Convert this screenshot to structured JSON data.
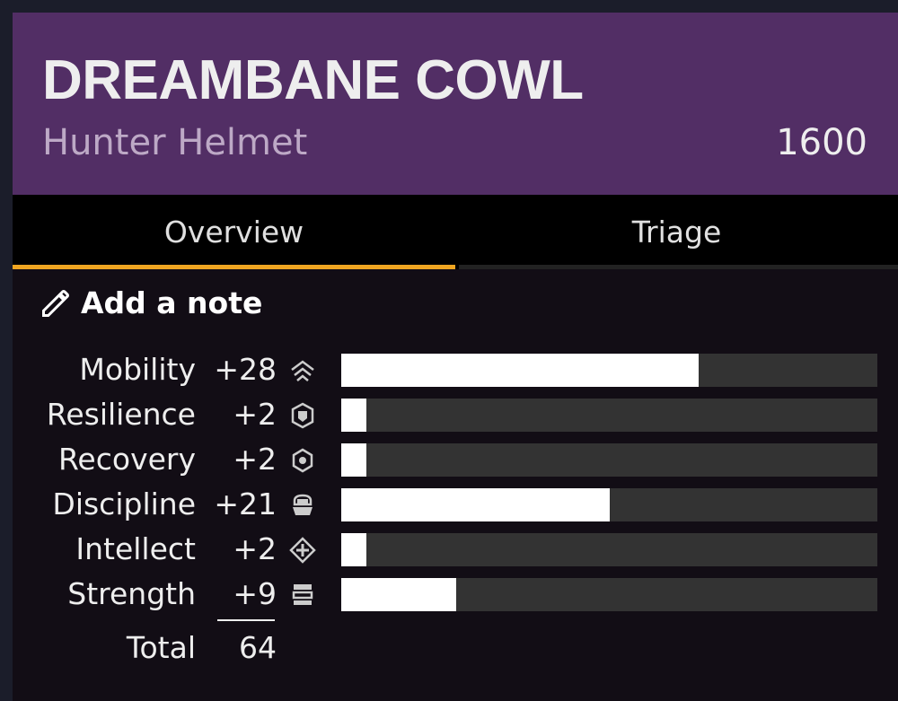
{
  "item": {
    "name": "DREAMBANE COWL",
    "type": "Hunter Helmet",
    "power": "1600"
  },
  "tabs": [
    {
      "label": "Overview",
      "active": true
    },
    {
      "label": "Triage",
      "active": false
    }
  ],
  "note": {
    "label": "Add a note",
    "icon": "pencil-icon"
  },
  "stat_max": 42,
  "stats": [
    {
      "name": "Mobility",
      "value": "+28",
      "amount": 28,
      "icon": "mobility-icon"
    },
    {
      "name": "Resilience",
      "value": "+2",
      "amount": 2,
      "icon": "resilience-icon"
    },
    {
      "name": "Recovery",
      "value": "+2",
      "amount": 2,
      "icon": "recovery-icon"
    },
    {
      "name": "Discipline",
      "value": "+21",
      "amount": 21,
      "icon": "discipline-icon"
    },
    {
      "name": "Intellect",
      "value": "+2",
      "amount": 2,
      "icon": "intellect-icon"
    },
    {
      "name": "Strength",
      "value": "+9",
      "amount": 9,
      "icon": "strength-icon"
    }
  ],
  "total": {
    "label": "Total",
    "value": "64"
  },
  "colors": {
    "header": "#522e65",
    "accent": "#f0a521",
    "bar_bg": "#333333",
    "bar_fill": "#ffffff"
  }
}
